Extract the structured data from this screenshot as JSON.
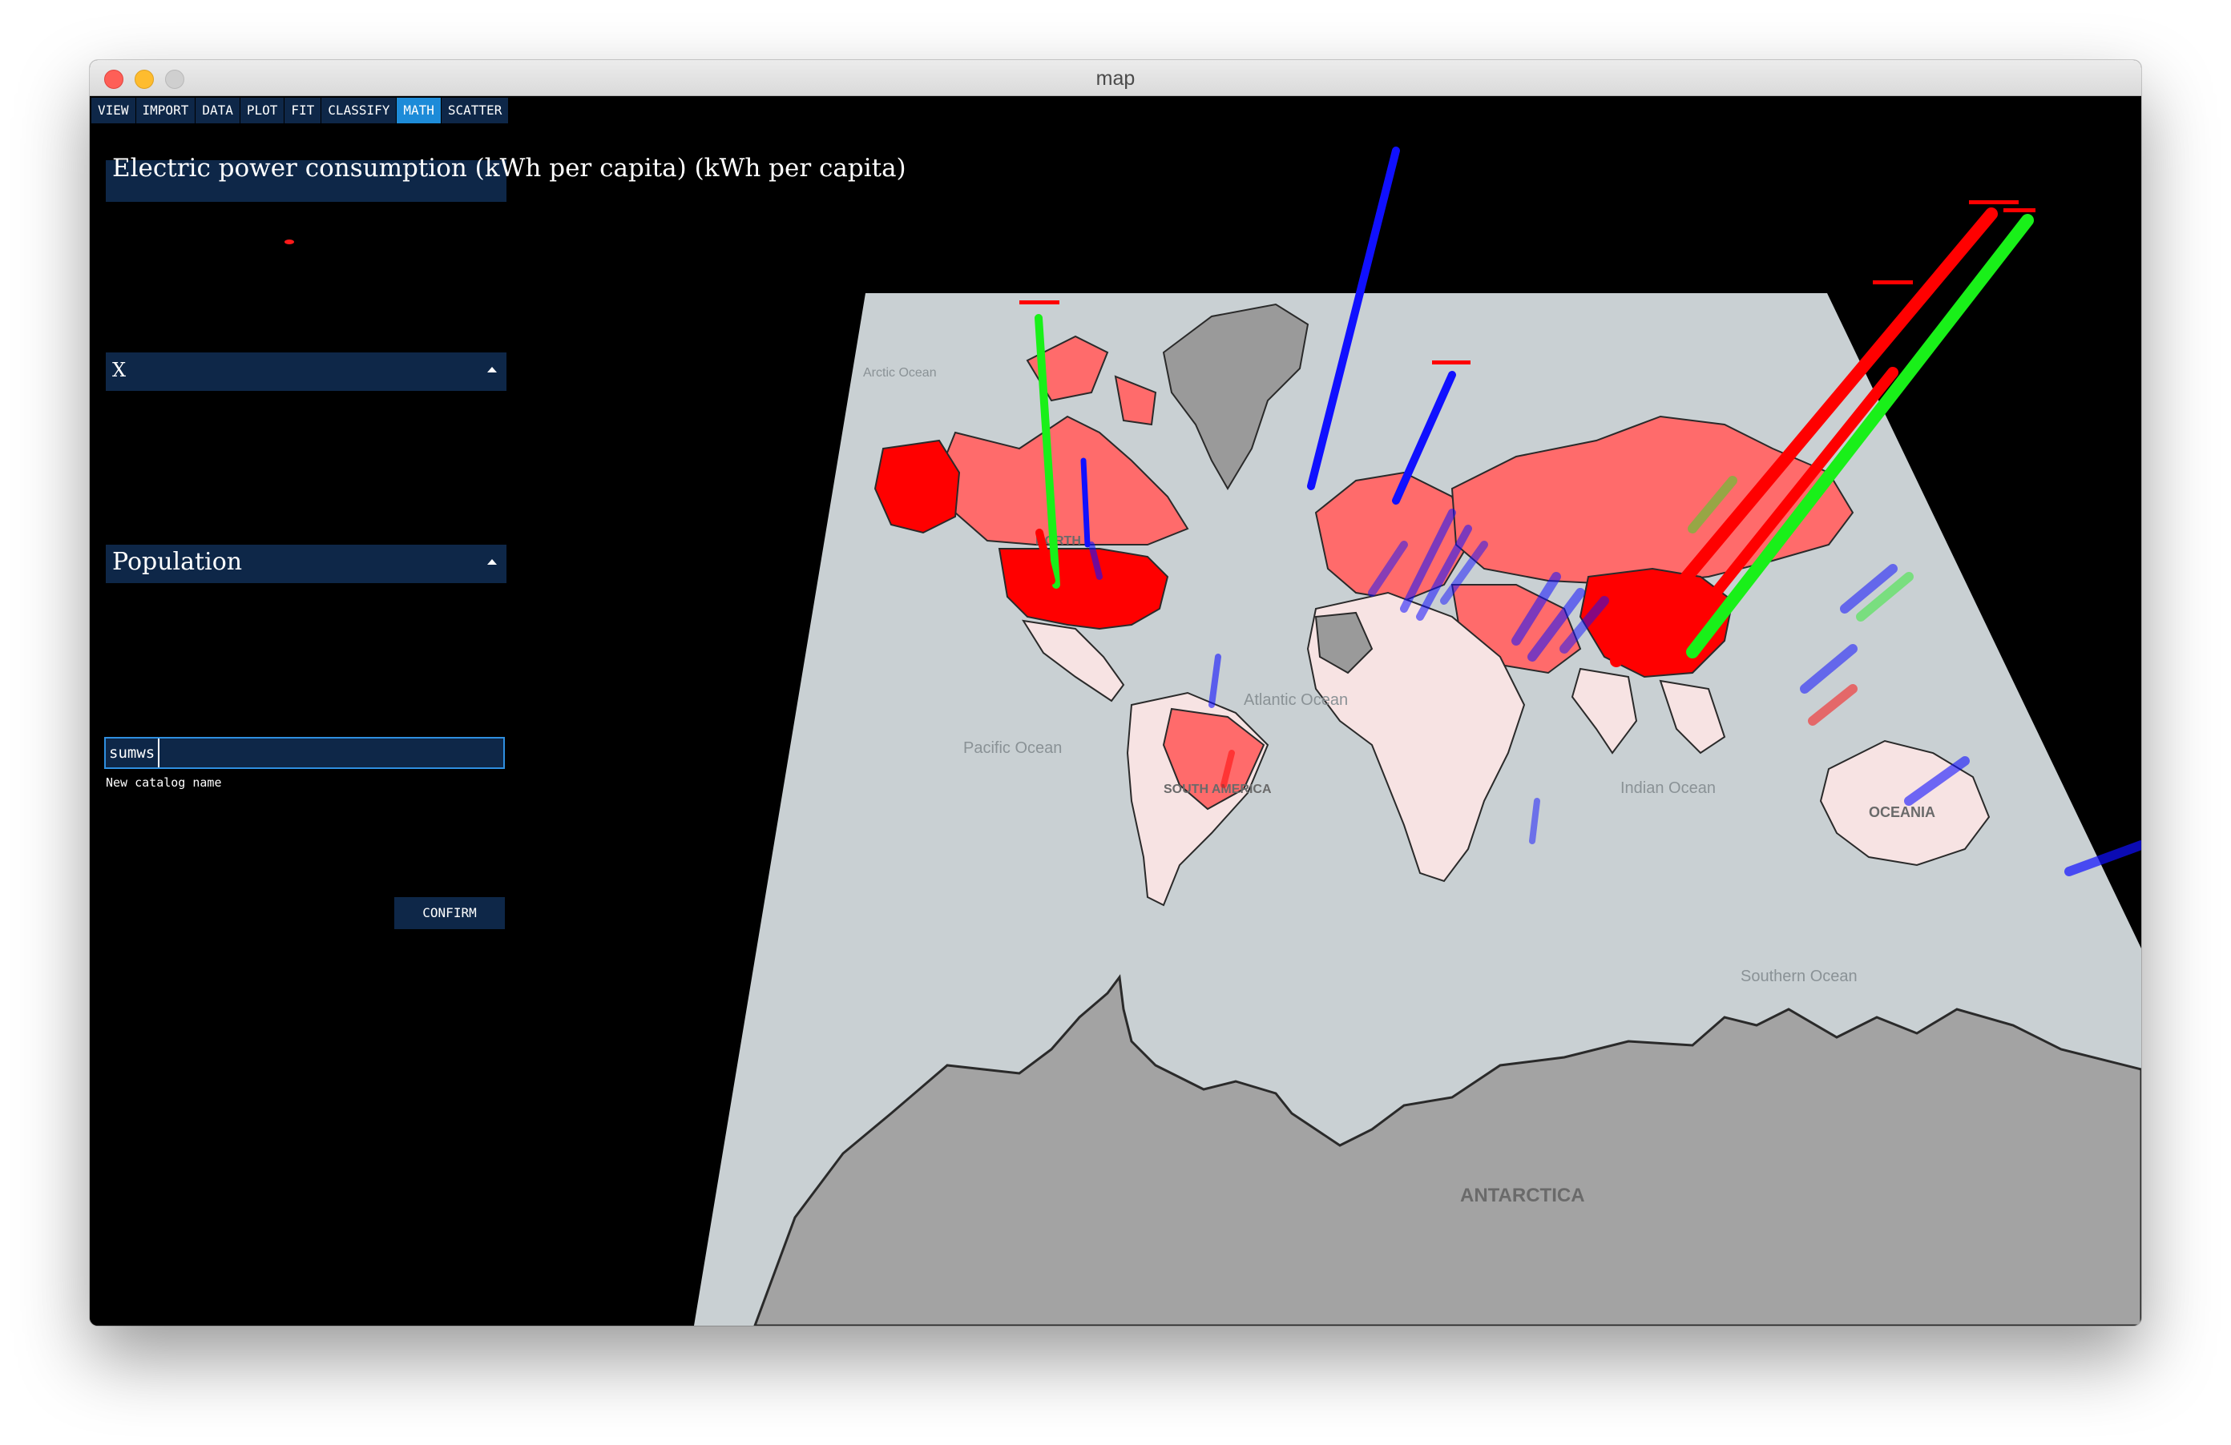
{
  "window": {
    "title": "map"
  },
  "menu": {
    "items": [
      {
        "label": "VIEW",
        "active": false
      },
      {
        "label": "IMPORT",
        "active": false
      },
      {
        "label": "DATA",
        "active": false
      },
      {
        "label": "PLOT",
        "active": false
      },
      {
        "label": "FIT",
        "active": false
      },
      {
        "label": "CLASSIFY",
        "active": false
      },
      {
        "label": "MATH",
        "active": true
      },
      {
        "label": "SCATTER",
        "active": false
      }
    ]
  },
  "panel": {
    "title": "Electric power consumption (kWh per capita) (kWh per capita)",
    "x_select": "X",
    "y_select": "Population",
    "catalog_input": {
      "value": "sumws",
      "caption": "New catalog name"
    },
    "confirm_label": "CONFIRM"
  },
  "map": {
    "labels": {
      "arctic": "Arctic Ocean",
      "pacific": "Pacific Ocean",
      "atlantic": "Atlantic Ocean",
      "indian": "Indian Ocean",
      "southern": "Southern Ocean",
      "oceania": "OCEANIA",
      "antarctica": "ANTARCTICA",
      "north_america": "NORTH",
      "south_america": "SOUTH AMERICA"
    }
  },
  "colors": {
    "ocean": "#c9d0d3",
    "land_gray": "#9e9e9e",
    "land_light": "#f7e3e3",
    "land_red": "#ff6b6b",
    "land_strong": "#ff0000",
    "bar_red": "#ff0000",
    "bar_green": "#19f019",
    "bar_blue": "#1010ff",
    "panel": "#0e2748",
    "active_tab": "#1d8bd8"
  }
}
